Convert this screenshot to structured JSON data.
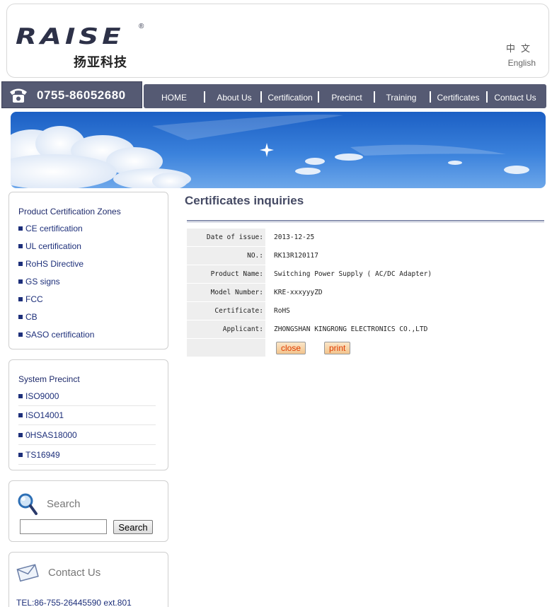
{
  "header": {
    "logo_text": "RAISE",
    "logo_registered": "®",
    "logo_cn": "扬亚科技",
    "lang_cn": "中文",
    "lang_en": "English"
  },
  "phone": "0755-86052680",
  "nav": [
    "HOME",
    "About Us",
    "Certification",
    "Precinct",
    "Training",
    "Certificates",
    "Contact Us"
  ],
  "sidebar": {
    "zones_title": "Product Certification Zones",
    "zones": [
      "CE certification",
      "UL certification",
      "RoHS Directive",
      "GS signs",
      "FCC",
      "CB",
      "SASO certification"
    ],
    "precinct_title": "System Precinct",
    "precinct": [
      "ISO9000",
      "ISO14001",
      "0HSAS18000",
      "TS16949"
    ],
    "search_title": "Search",
    "search_value": "",
    "search_button": "Search",
    "contact_title": "Contact Us",
    "tel": "TEL:86-755-26445590 ext.801"
  },
  "main": {
    "title": "Certificates inquiries",
    "rows": [
      {
        "label": "Date of issue:",
        "value": "2013-12-25"
      },
      {
        "label": "NO.:",
        "value": "RK13R120117"
      },
      {
        "label": "Product Name:",
        "value": "Switching Power Supply ( AC/DC Adapter)"
      },
      {
        "label": "Model Number:",
        "value": "KRE-xxxyyyZD"
      },
      {
        "label": "Certificate:",
        "value": "RoHS"
      },
      {
        "label": "Applicant:",
        "value": "ZHONGSHAN KINGRONG ELECTRONICS CO.,LTD"
      }
    ],
    "close_button": "close",
    "print_button": "print"
  },
  "colors": {
    "nav_bg": "#555a73",
    "link": "#1d2f7a",
    "button_text": "#e03c00"
  }
}
